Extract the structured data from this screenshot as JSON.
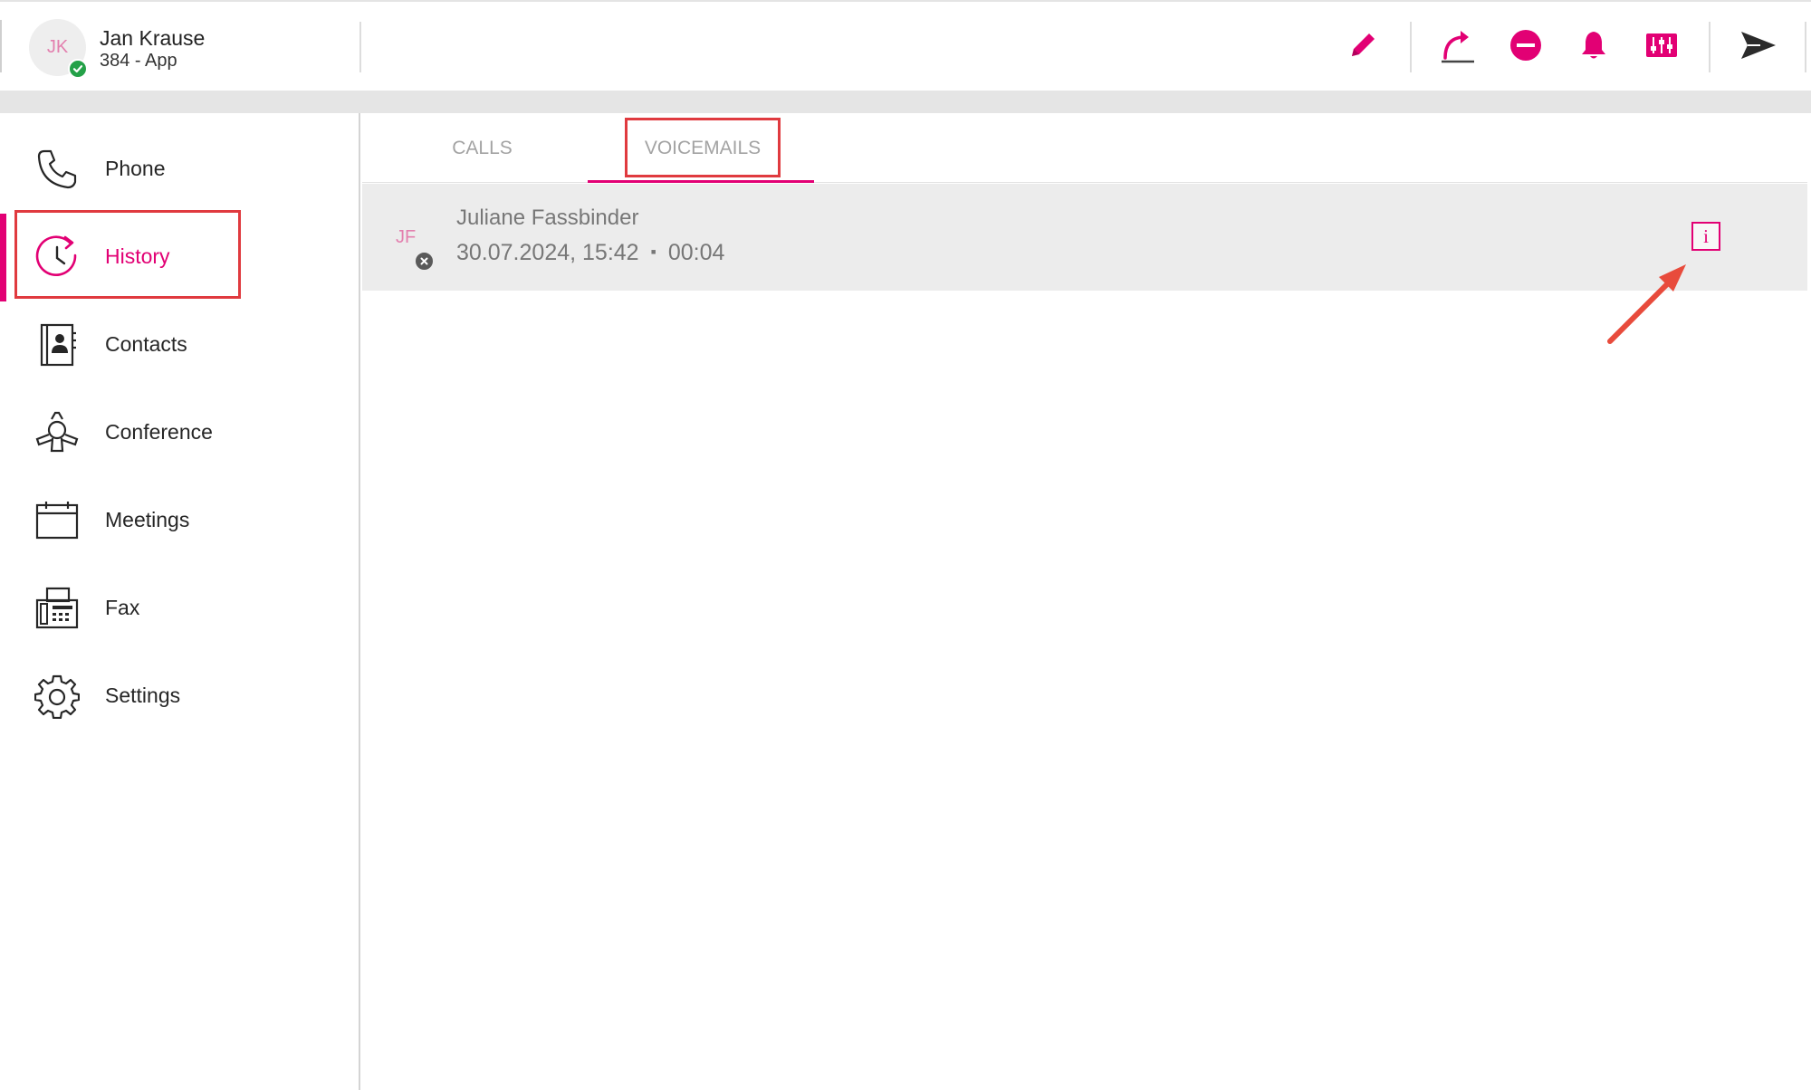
{
  "header": {
    "user_initials": "JK",
    "user_name": "Jan Krause",
    "user_subtitle": "384 - App",
    "presence_status": "available",
    "actions": [
      {
        "name": "edit-icon"
      },
      {
        "name": "call-forward-icon"
      },
      {
        "name": "do-not-disturb-icon"
      },
      {
        "name": "notification-bell-icon"
      },
      {
        "name": "audio-settings-icon"
      },
      {
        "name": "send-icon"
      }
    ]
  },
  "sidebar": {
    "items": [
      {
        "label": "Phone",
        "icon": "phone-icon"
      },
      {
        "label": "History",
        "icon": "history-icon",
        "active": true
      },
      {
        "label": "Contacts",
        "icon": "contacts-icon"
      },
      {
        "label": "Conference",
        "icon": "conference-icon"
      },
      {
        "label": "Meetings",
        "icon": "calendar-icon"
      },
      {
        "label": "Fax",
        "icon": "fax-icon"
      },
      {
        "label": "Settings",
        "icon": "gear-icon"
      }
    ]
  },
  "tabs": [
    {
      "label": "CALLS",
      "active": false
    },
    {
      "label": "VOICEMAILS",
      "active": true
    }
  ],
  "voicemails": [
    {
      "initials": "JF",
      "name": "Juliane Fassbinder",
      "date_time": "30.07.2024, 15:42",
      "separator": "▪",
      "duration": "00:04",
      "info_label": "i"
    }
  ],
  "colors": {
    "accent": "#e20074",
    "highlight": "#e03a3f",
    "presence_green": "#24a148"
  }
}
